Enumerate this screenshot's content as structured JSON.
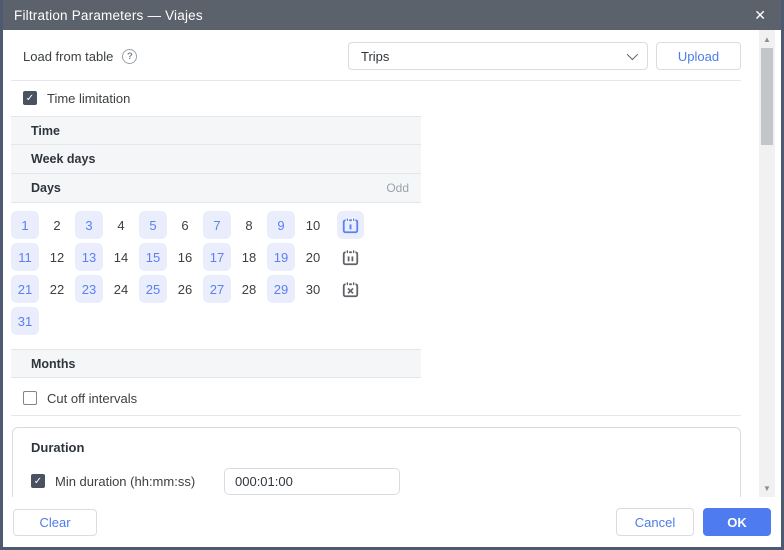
{
  "dialog": {
    "title": "Filtration Parameters — Viajes",
    "close_icon": "✕"
  },
  "load_row": {
    "label": "Load from table",
    "help_icon": "?",
    "table_select_value": "Trips",
    "upload_label": "Upload"
  },
  "time_limitation": {
    "label": "Time limitation",
    "checked": true,
    "check_glyph": "✓"
  },
  "sections": {
    "time": "Time",
    "week_days": "Week days",
    "days": "Days",
    "days_mode": "Odd",
    "months": "Months"
  },
  "calendar": {
    "days": [
      1,
      2,
      3,
      4,
      5,
      6,
      7,
      8,
      9,
      10,
      11,
      12,
      13,
      14,
      15,
      16,
      17,
      18,
      19,
      20,
      21,
      22,
      23,
      24,
      25,
      26,
      27,
      28,
      29,
      30,
      31
    ],
    "selected_days": [
      1,
      3,
      5,
      7,
      9,
      11,
      13,
      15,
      17,
      19,
      21,
      23,
      25,
      27,
      29,
      31
    ],
    "days_per_row": 10,
    "row_icons": [
      "select-odd-days-icon",
      "select-even-days-icon",
      "clear-days-icon"
    ],
    "active_icon": "select-odd-days-icon"
  },
  "cut_off_intervals": {
    "label": "Cut off intervals",
    "checked": false
  },
  "duration": {
    "title": "Duration",
    "min_duration_label": "Min duration (hh:mm:ss)",
    "min_duration_checked": true,
    "min_duration_value": "000:01:00",
    "check_glyph": "✓"
  },
  "footer": {
    "clear": "Clear",
    "cancel": "Cancel",
    "ok": "OK"
  },
  "colors": {
    "titlebar": "#5b626b",
    "dialog_border": "#4e5a70",
    "accent_blue": "#4d7cea",
    "ok_button": "#4e7cf0",
    "selected_day_bg": "#e9edfc",
    "selected_day_text": "#5b80f2",
    "section_row_bg": "#f5f6f7",
    "checkbox_checked": "#4a5260"
  }
}
